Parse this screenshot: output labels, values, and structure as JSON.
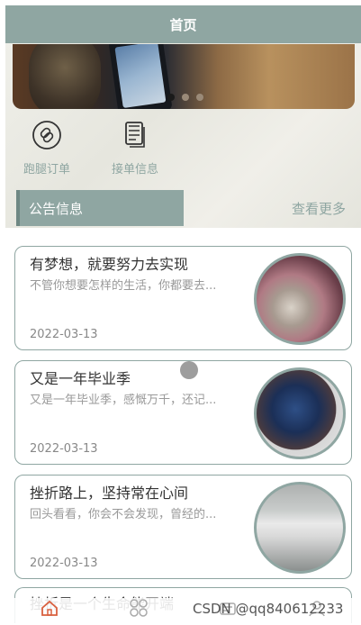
{
  "header": {
    "title": "首页"
  },
  "banner": {
    "slides": 3,
    "active_index": 0
  },
  "quick_actions": [
    {
      "label": "跑腿订单",
      "icon": "link-icon"
    },
    {
      "label": "接单信息",
      "icon": "document-icon"
    }
  ],
  "notice": {
    "title": "公告信息",
    "more": "查看更多"
  },
  "cards": [
    {
      "title": "有梦想，就要努力去实现",
      "desc": "不管你想要怎样的生活，你都要去...",
      "date": "2022-03-13",
      "image": "watch-on-wrist"
    },
    {
      "title": "又是一年毕业季",
      "desc": "又是一年毕业季，感慨万千，还记...",
      "date": "2022-03-13",
      "image": "blue-watch"
    },
    {
      "title": "挫折路上，坚持常在心间",
      "desc": "回头看看，你会不会发现，曾经的...",
      "date": "2022-03-13",
      "image": "sofa"
    },
    {
      "title": "挫折是一个生命能开端"
    }
  ],
  "tabbar": {
    "icons": [
      "home-icon",
      "category-icon",
      "message-icon",
      "user-icon"
    ]
  },
  "watermark": {
    "text": "CSDN @qq840612233"
  },
  "colors": {
    "accent": "#8fa6a2",
    "header_text": "#ffffff"
  }
}
